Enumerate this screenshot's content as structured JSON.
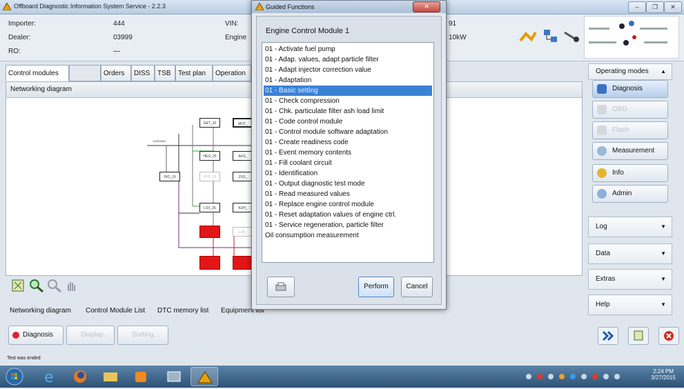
{
  "window": {
    "title": "Offboard Diagnostic Information System Service - 2.2.3",
    "controls": [
      "–",
      "❐",
      "✕"
    ]
  },
  "header": {
    "importer_label": "Importer:",
    "importer_value": "444",
    "dealer_label": "Dealer:",
    "dealer_value": "03999",
    "ro_label": "RO:",
    "ro_value": "—",
    "vin_label": "VIN:",
    "engine_label": "Engine",
    "vin_value_partial": "91",
    "power_value": "10kW"
  },
  "tabs": [
    "Control modules",
    "Orders",
    "DISS",
    "TSB",
    "Test plan",
    "Operation"
  ],
  "content": {
    "title": "Networking diagram",
    "nodes": [
      "GET_32",
      "MOT_",
      "HEG_25",
      "AUS_",
      "DIO_19",
      "HYP_03",
      "ZUS_",
      "LSV_26",
      "KUH_",
      "LUK_"
    ]
  },
  "bottom_tabs": [
    "Networking diagram",
    "Control Module List",
    "DTC memory list",
    "Equipment list"
  ],
  "bottom_buttons": {
    "diagnosis": "Diagnosis",
    "display": "Display...",
    "sorting": "Sorting..."
  },
  "status_text": "Test was ended",
  "right_panel": {
    "operating_modes": "Operating modes",
    "diagnosis": "Diagnosis",
    "obd": "OBD",
    "flash": "Flash",
    "measurement": "Measurement",
    "info": "Info",
    "admin": "Admin",
    "log": "Log",
    "data": "Data",
    "extras": "Extras",
    "help": "Help"
  },
  "dialog": {
    "title": "Guided Functions",
    "heading": "Engine Control Module 1",
    "items": [
      "01 - Activate fuel pump",
      "01 - Adap. values, adapt particle filter",
      "01 - Adapt injector correction value",
      "01 - Adaptation",
      "01 - Basic setting",
      "01 - Check compression",
      "01 - Chk. particulate filter ash load limit",
      "01 - Code control module",
      "01 - Control module software adaptation",
      "01 - Create readiness code",
      "01 - Event memory contents",
      "01 - Fill coolant circuit",
      "01 - Identification",
      "01 - Output diagnostic test mode",
      "01 - Read measured values",
      "01 - Replace engine control module",
      "01 - Reset adaptation values of engine ctrl.",
      "01 - Service regeneration, particle filter",
      "Oil consumption measurement"
    ],
    "selected_index": 4,
    "perform_label": "Perform",
    "cancel_label": "Cancel"
  },
  "taskbar": {
    "time": "2:24 PM",
    "date": "3/27/2015"
  },
  "colors": {
    "selection": "#3b82d6",
    "node_fault": "#e21616",
    "taskbar": "#2c5275"
  }
}
